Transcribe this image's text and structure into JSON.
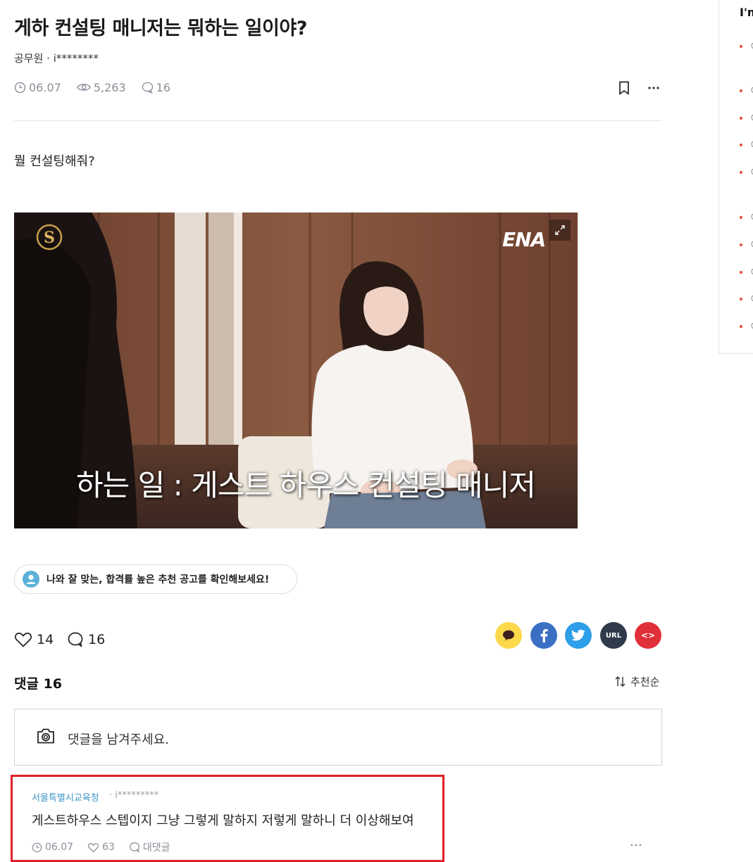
{
  "post": {
    "title": "게하 컨설팅 매니저는 뭐하는 일이야?",
    "author": "공무원 · i********",
    "date": "06.07",
    "views": "5,263",
    "comments": "16",
    "body": "뭘 컨설팅해줘?"
  },
  "image": {
    "channel_logo": "ENA",
    "caption": "하는 일 : 게스트 하우스 컨설팅 매니저"
  },
  "recommend": {
    "label": "나와 잘 맞는, 합격률 높은 추천 공고를 확인해보세요!"
  },
  "reactions": {
    "likes": "14",
    "comments": "16"
  },
  "share": {
    "url_label": "URL",
    "embed_label": "<>"
  },
  "comments_section": {
    "title": "댓글 16",
    "sort_label": "추천순",
    "input_placeholder": "댓글을 남겨주세요."
  },
  "comment": {
    "author": "서울특별시교육청",
    "user_id": "· i*********",
    "text": "게스트하우스 스텝이지 그냥 그렇게 말하지 저렇게 말하니 더 이상해보여",
    "date": "06.07",
    "likes": "63",
    "reply_label": "대댓글"
  },
  "sidebar": {
    "title": "I'm",
    "items": [
      "○",
      "○",
      "○",
      "○",
      "○",
      "○",
      "○",
      "○",
      "○",
      "○"
    ]
  },
  "colors": {
    "accent_red": "#e0202a",
    "link_blue": "#3c95c9",
    "kakao": "#fbd94a",
    "facebook": "#3b6fc4",
    "twitter": "#2d9ee8"
  }
}
